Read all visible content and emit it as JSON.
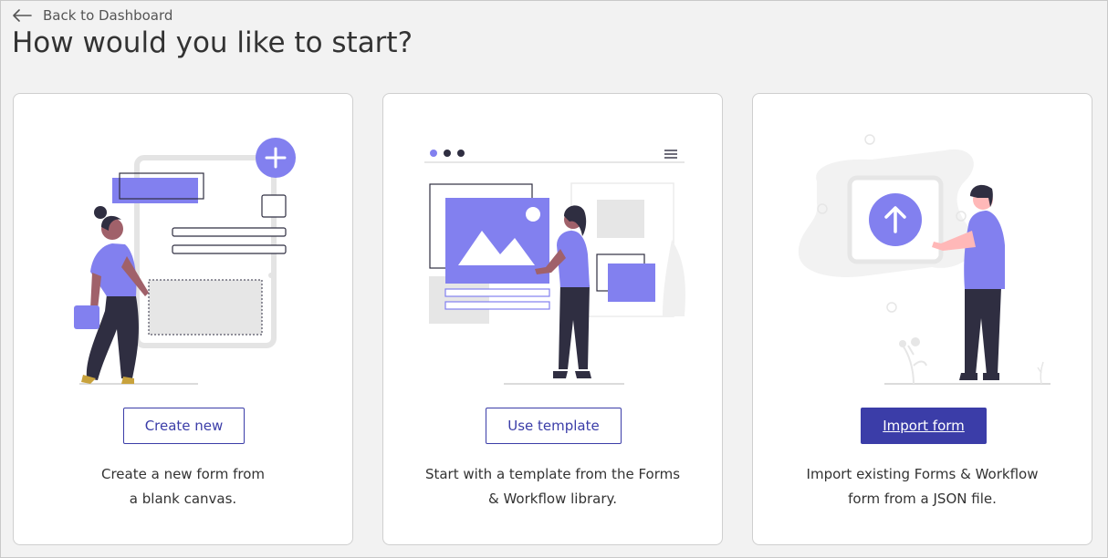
{
  "nav": {
    "back_label": "Back to Dashboard"
  },
  "page": {
    "title": "How would you like to start?"
  },
  "options": [
    {
      "button_label": "Create new",
      "desc_line1": "Create a new form from",
      "desc_line2": "a blank canvas."
    },
    {
      "button_label": "Use template",
      "desc_line1": "Start with a template from the Forms",
      "desc_line2": "& Workflow library."
    },
    {
      "button_label": "Import form",
      "desc_line1": "Import existing Forms & Workflow",
      "desc_line2": "form from a JSON file."
    }
  ],
  "colors": {
    "accent": "#3b3da8",
    "illustration_purple": "#8280ef",
    "dark": "#2f2e41",
    "background": "#f2f2f2"
  },
  "icons": [
    "arrow-left-icon",
    "plus-icon",
    "arrow-up-icon",
    "menu-icon"
  ]
}
